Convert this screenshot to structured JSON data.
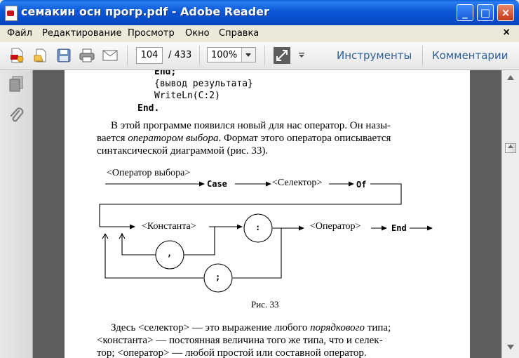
{
  "window": {
    "title": "семакин осн прогр.pdf - Adobe Reader",
    "minimize": "_",
    "maximize": "□",
    "close": "×"
  },
  "menu": {
    "items": [
      "Файл",
      "Редактирование",
      "Просмотр",
      "Окно",
      "Справка"
    ],
    "close_doc": "×"
  },
  "toolbar": {
    "page_current": "104",
    "page_total": "/ 433",
    "zoom": "100%",
    "tools_label": "Инструменты",
    "comments_label": "Комментарии"
  },
  "document": {
    "code_lines": [
      "End;",
      "{вывод результата}",
      "WriteLn(C:2)",
      "End."
    ],
    "para1": {
      "line1": "В этой программе появился новый для нас оператор. Он назы-",
      "line2_pre": "вается ",
      "line2_em": "оператором выбора",
      "line2_post": ". Формат этого оператора описывается",
      "line3": "синтаксической диаграммой (рис. 33)."
    },
    "diagram": {
      "label_operator_select": "<Оператор выбора>",
      "kw_case": "Case",
      "label_selector": "<Селектор>",
      "kw_of": "Of",
      "label_constant": "<Константа>",
      "symbol_colon": ":",
      "label_operator": "<Оператор>",
      "kw_end": "End",
      "symbol_comma": ",",
      "symbol_semicolon": ";"
    },
    "caption": "Рис. 33",
    "para2": {
      "line1_pre": "Здесь <селектор> —  это выражение любого ",
      "line1_em": "порядкового",
      "line1_post": " типа;",
      "line2": "<константа> — постоянная величина того же типа, что и селек-",
      "line3": "тор; <оператор> — любой простой или составной оператор."
    }
  }
}
